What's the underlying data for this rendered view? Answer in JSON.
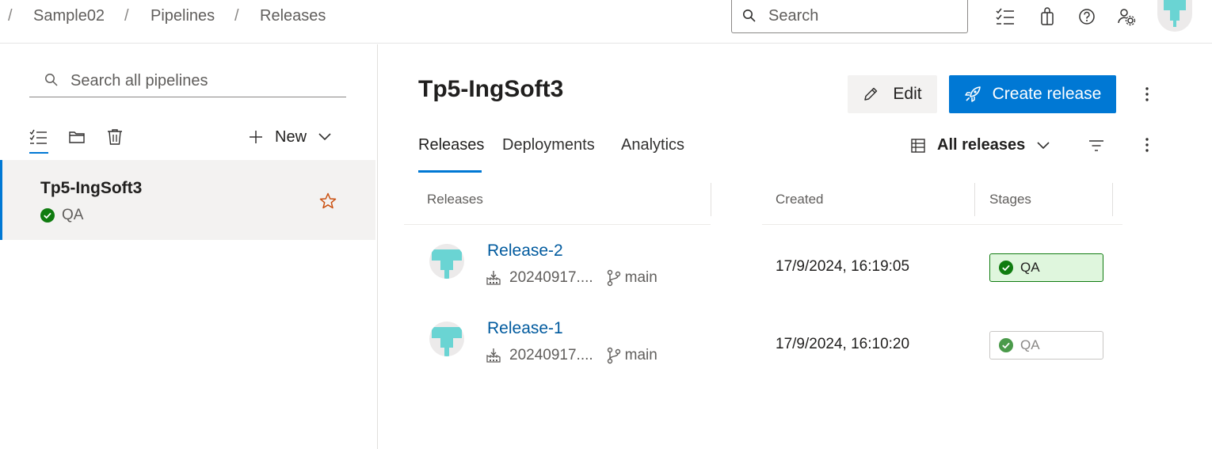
{
  "breadcrumb": {
    "items": [
      "Sample02",
      "Pipelines",
      "Releases"
    ],
    "separator": "/"
  },
  "header": {
    "search_placeholder": "Search",
    "icons": [
      "work-items-icon",
      "marketplace-bag-icon",
      "help-icon",
      "user-settings-icon",
      "user-avatar"
    ]
  },
  "sidebar": {
    "search_placeholder": "Search all pipelines",
    "view_icons": [
      "list-view-icon",
      "folder-view-icon",
      "deleted-icon"
    ],
    "new_label": "New",
    "pipelines": [
      {
        "name": "Tp5-IngSoft3",
        "status": "QA",
        "status_icon": "success-check-icon",
        "favorite_icon": "star-icon"
      }
    ]
  },
  "main": {
    "title": "Tp5-IngSoft3",
    "edit_label": "Edit",
    "create_release_label": "Create release",
    "tabs": [
      {
        "label": "Releases",
        "active": true
      },
      {
        "label": "Deployments",
        "active": false
      },
      {
        "label": "Analytics",
        "active": false
      }
    ],
    "view_filter": "All releases",
    "table": {
      "columns": [
        "Releases",
        "Created",
        "Stages"
      ],
      "rows": [
        {
          "name": "Release-2",
          "artifact": "20240917....",
          "branch": "main",
          "created": "17/9/2024, 16:19:05",
          "stage": "QA",
          "stage_state": "success"
        },
        {
          "name": "Release-1",
          "artifact": "20240917....",
          "branch": "main",
          "created": "17/9/2024, 16:10:20",
          "stage": "QA",
          "stage_state": "not-current"
        }
      ]
    }
  },
  "colors": {
    "accent": "#0078d4",
    "link": "#005a9e",
    "success": "#107c10",
    "success_bg": "#dff6dd",
    "avatar_teal": "#6ad4d3"
  }
}
